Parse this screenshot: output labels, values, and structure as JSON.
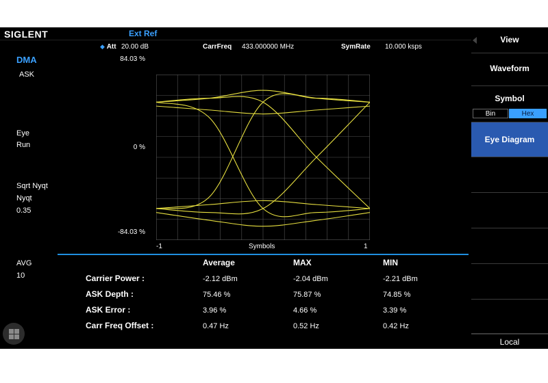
{
  "brand": "SIGLENT",
  "ref_status": "Ext Ref",
  "header": {
    "att_label": "Att",
    "att_value": "20.00 dB",
    "carrfreq_label": "CarrFreq",
    "carrfreq_value": "433.000000 MHz",
    "symrate_label": "SymRate",
    "symrate_value": "10.000 ksps"
  },
  "left_panel": {
    "mode": "DMA",
    "modulation": "ASK",
    "display_label": "Eye",
    "run_state": "Run",
    "filter_label": "Sqrt Nyqt",
    "filter_type": "Nyqt",
    "filter_alpha": "0.35",
    "avg_label": "AVG",
    "avg_value": "10"
  },
  "chart": {
    "y_top": "84.03 %",
    "y_mid": "0 %",
    "y_bottom": "-84.03 %",
    "x_left": "-1",
    "x_mid": "Symbols",
    "x_right": "1",
    "trace_color": "#e8e040",
    "grid_color": "#555555"
  },
  "chart_data": {
    "type": "line",
    "title": "",
    "xlabel": "Symbols",
    "ylabel": "",
    "xlim": [
      -1,
      1
    ],
    "ylim": [
      -84.03,
      84.03
    ],
    "grid": true,
    "series": [
      {
        "x": [
          -1,
          -0.5,
          0,
          0.5,
          1
        ],
        "y": [
          56,
          60,
          68,
          60,
          56
        ]
      },
      {
        "x": [
          -1,
          -0.5,
          0,
          0.5,
          1
        ],
        "y": [
          52,
          48,
          44,
          48,
          52
        ]
      },
      {
        "x": [
          -1,
          -0.5,
          0,
          0.5,
          1
        ],
        "y": [
          -52,
          -48,
          -44,
          -48,
          -52
        ]
      },
      {
        "x": [
          -1,
          -0.5,
          0,
          0.5,
          1
        ],
        "y": [
          -56,
          -64,
          -70,
          -64,
          -56
        ]
      },
      {
        "x": [
          -1,
          -0.5,
          0,
          0.5,
          1
        ],
        "y": [
          56,
          40,
          -52,
          -56,
          -52
        ]
      },
      {
        "x": [
          -1,
          -0.5,
          0,
          0.5,
          1
        ],
        "y": [
          -52,
          -40,
          56,
          60,
          56
        ]
      },
      {
        "x": [
          -1,
          -0.5,
          0,
          0.5,
          1
        ],
        "y": [
          56,
          60,
          56,
          0,
          -52
        ]
      },
      {
        "x": [
          -1,
          -0.5,
          0,
          0.5,
          1
        ],
        "y": [
          -52,
          -56,
          -52,
          0,
          56
        ]
      }
    ]
  },
  "stats": {
    "columns": [
      "Average",
      "MAX",
      "MIN"
    ],
    "rows": [
      {
        "label": "Carrier Power :",
        "values": [
          "-2.12 dBm",
          "-2.04 dBm",
          "-2.21 dBm"
        ]
      },
      {
        "label": "ASK Depth :",
        "values": [
          "75.46 %",
          "75.87 %",
          "74.85 %"
        ]
      },
      {
        "label": "ASK Error :",
        "values": [
          "3.96 %",
          "4.66 %",
          "3.39 %"
        ]
      },
      {
        "label": "Carr Freq Offset :",
        "values": [
          "0.47 Hz",
          "0.52 Hz",
          "0.42 Hz"
        ]
      }
    ]
  },
  "softkeys": {
    "view": "View",
    "waveform": "Waveform",
    "symbol": "Symbol",
    "bin": "Bin",
    "hex": "Hex",
    "eye_diagram": "Eye Diagram",
    "local": "Local"
  },
  "colors": {
    "accent": "#3aa0ff",
    "active_key": "#2a5ab0",
    "trace": "#e8e040",
    "background": "#000000"
  },
  "icons": {
    "menu": "grid-menu-icon",
    "panel": "collapse-triangle-icon"
  }
}
